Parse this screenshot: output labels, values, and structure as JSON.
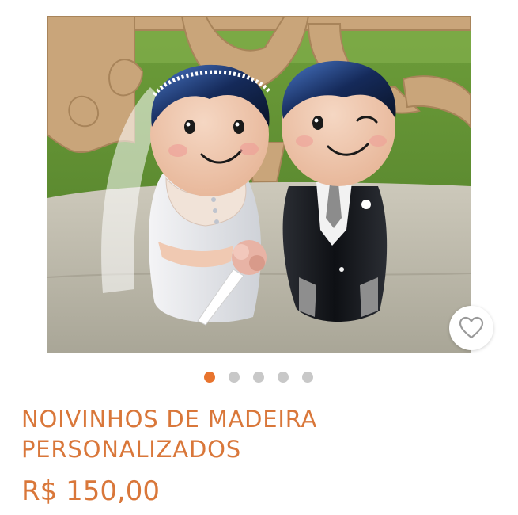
{
  "product": {
    "title_line1": "NOIVINHOS DE MADEIRA",
    "title_line2": "PERSONALIZADOS",
    "price": "R$ 150,00",
    "image_alt": "wooden bride and groom figurines",
    "favorite_icon": "heart-outline-icon"
  },
  "carousel": {
    "slide_count": 5,
    "active_index": 0
  },
  "colors": {
    "accent": "#e8742e",
    "text_accent": "#d9773a",
    "dot_inactive": "#c8c8c8"
  }
}
